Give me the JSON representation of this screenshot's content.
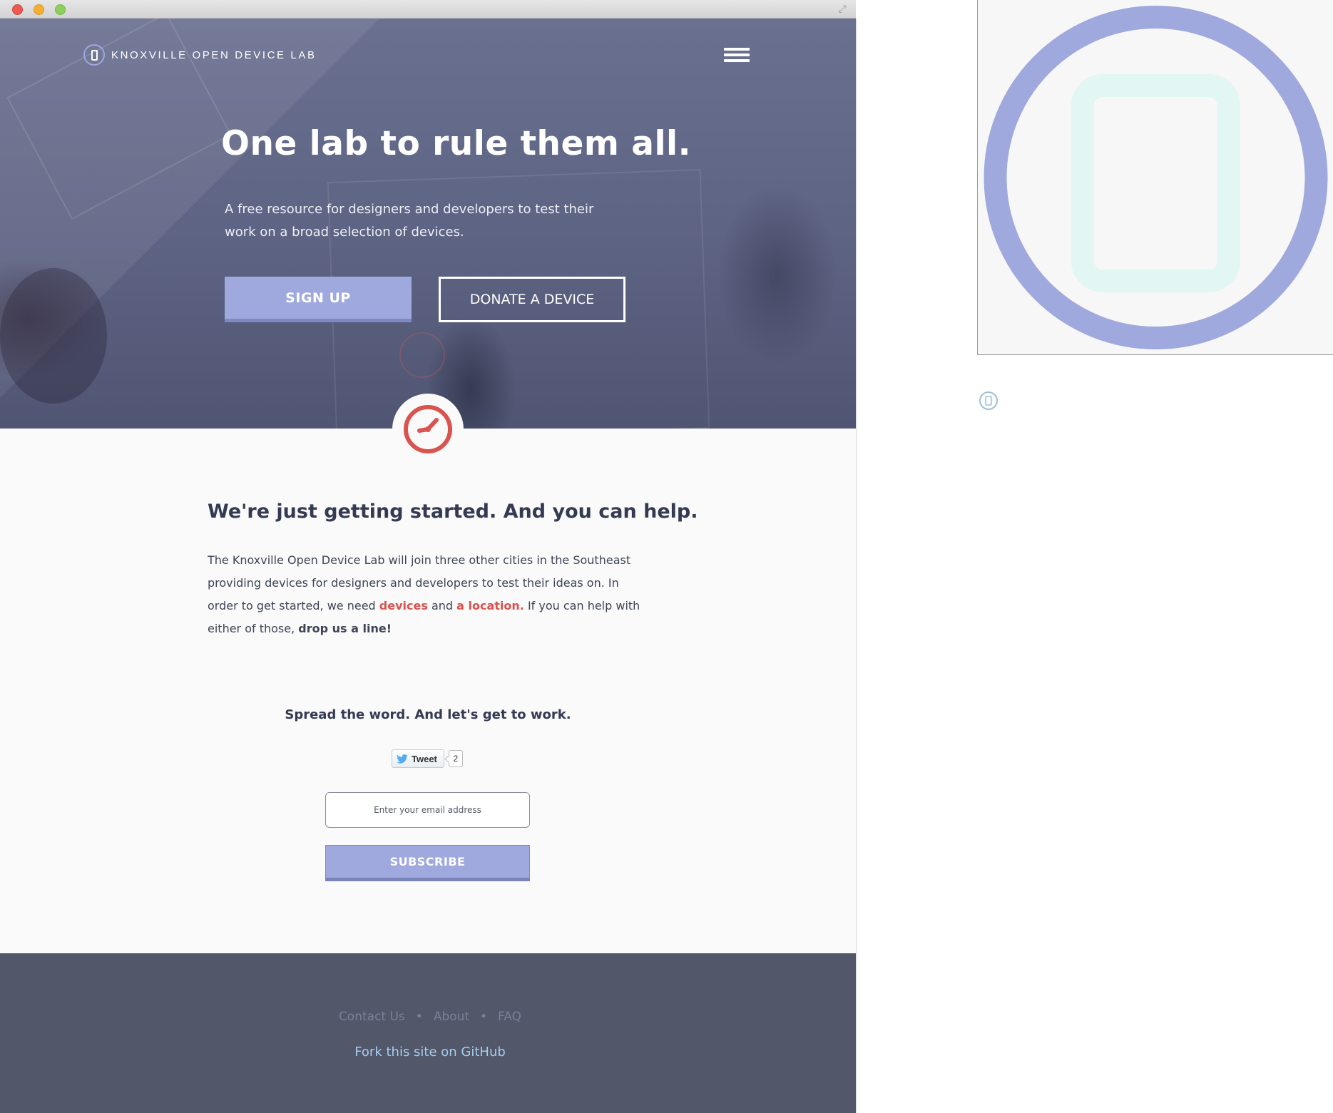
{
  "brand": {
    "name": "KNOXVILLE OPEN DEVICE LAB",
    "accent_color": "#9fa9de",
    "alert_color": "#d9534f"
  },
  "header": {
    "menu_icon": "hamburger-menu-icon"
  },
  "hero": {
    "title": "One lab to rule them all.",
    "subtitle": "A free resource for designers and developers to test their work on a broad selection of devices.",
    "signup_label": "SIGN UP",
    "donate_label": "DONATE A DEVICE"
  },
  "badge": {
    "icon": "clock-icon"
  },
  "content": {
    "title": "We're just getting started. And you can help.",
    "body_1": "The Knoxville Open Device Lab will join three other cities in the Southeast providing devices for designers and developers to test their ideas on. In order to get started, we need ",
    "link_devices": "devices",
    "body_2": " and ",
    "link_location": "a location.",
    "body_3": " If you can help with either of those, ",
    "link_drop": "drop us a line!"
  },
  "share": {
    "heading": "Spread the word. And let's get to work.",
    "tweet_label": "Tweet",
    "tweet_count": "2",
    "email_placeholder": "Enter your email address",
    "subscribe_label": "SUBSCRIBE"
  },
  "footer": {
    "links": [
      "Contact Us",
      "About",
      "FAQ"
    ],
    "separator": "•",
    "github_label": "Fork this site on GitHub"
  },
  "assets": {
    "large_icon": "device-lab-logo-icon",
    "small_icon": "device-lab-logo-small-icon"
  }
}
